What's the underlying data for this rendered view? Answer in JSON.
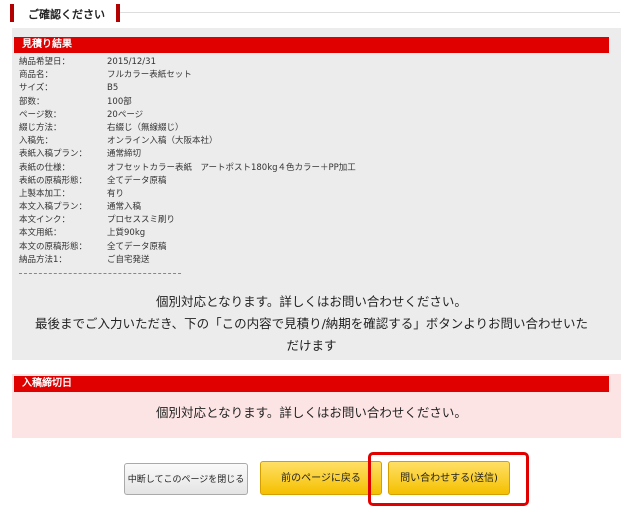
{
  "header": {
    "title": "ご確認ください"
  },
  "estimate": {
    "bar_label": "見積り結果",
    "rows": [
      {
        "label": "納品希望日：",
        "value": "2015/12/31"
      },
      {
        "label": "商品名：",
        "value": "フルカラー表紙セット"
      },
      {
        "label": "サイズ：",
        "value": "B5"
      },
      {
        "label": "部数：",
        "value": "100部"
      },
      {
        "label": "ページ数：",
        "value": "20ページ"
      },
      {
        "label": "綴じ方法：",
        "value": "右綴じ（無線綴じ）"
      },
      {
        "label": "入稿先：",
        "value": "オンライン入稿（大阪本社）"
      },
      {
        "label": "表紙入稿プラン：",
        "value": "通常締切"
      },
      {
        "label": "表紙の仕様：",
        "value": "オフセットカラー表紙　アートポスト180kg４色カラー＋PP加工"
      },
      {
        "label": "表紙の原稿形態：",
        "value": "全てデータ原稿"
      },
      {
        "label": "上製本加工：",
        "value": "有り"
      },
      {
        "label": "本文入稿プラン：",
        "value": "通常入稿"
      },
      {
        "label": "本文インク：",
        "value": "プロセススミ刷り"
      },
      {
        "label": "本文用紙：",
        "value": "上質90kg"
      },
      {
        "label": "本文の原稿形態：",
        "value": "全てデータ原稿"
      },
      {
        "label": "納品方法1：",
        "value": "ご自宅発送"
      }
    ],
    "notice_line1": "個別対応となります。詳しくはお問い合わせください。",
    "notice_line2": "最後までご入力いただき、下の「この内容で見積り/納期を確認する」ボタンよりお問い合わせいた",
    "notice_line3": "だけます"
  },
  "deadline": {
    "bar_label": "入稿締切日",
    "notice": "個別対応となります。詳しくはお問い合わせください。"
  },
  "buttons": {
    "close": "中断してこのページを閉じる",
    "back": "前のページに戻る",
    "send": "問い合わせする(送信)"
  },
  "colors": {
    "accent_red": "#e00000",
    "button_yellow": "#f5c000",
    "pink_panel": "#fde4e4",
    "gray_panel": "#ececec"
  }
}
